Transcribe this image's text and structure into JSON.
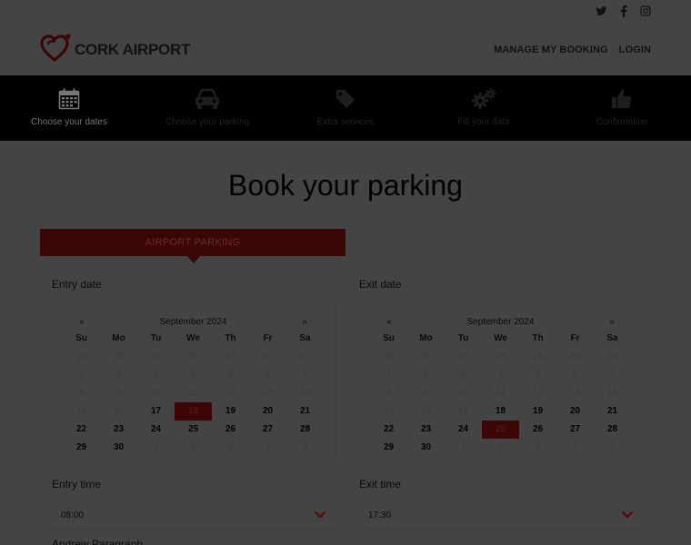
{
  "social": {
    "icons": [
      "twitter-icon",
      "facebook-icon",
      "instagram-icon"
    ]
  },
  "header": {
    "logo_text": "CORK AIRPORT",
    "nav": [
      "MANAGE MY BOOKING",
      "LOGIN"
    ]
  },
  "steps": [
    {
      "label": "Choose your dates",
      "icon": "calendar-icon"
    },
    {
      "label": "Choose your parking",
      "icon": "car-icon"
    },
    {
      "label": "Extra services",
      "icon": "tag-icon"
    },
    {
      "label": "Fill your data",
      "icon": "gears-icon"
    },
    {
      "label": "Confirmation",
      "icon": "thumbs-up-icon"
    }
  ],
  "page_title": "Book your parking",
  "tab_label": "AIRPORT PARKING",
  "entry": {
    "label": "Entry date",
    "prev": "«",
    "next": "»",
    "month": "September 2024",
    "days": [
      "Su",
      "Mo",
      "Tu",
      "We",
      "Th",
      "Fr",
      "Sa"
    ],
    "cells": [
      "25",
      "26",
      "27",
      "28",
      "29",
      "30",
      "31",
      "1",
      "2",
      "3",
      "4",
      "5",
      "6",
      "7",
      "8",
      "9",
      "10",
      "11",
      "12",
      "13",
      "14",
      "15",
      "16",
      "17",
      "18",
      "19",
      "20",
      "21",
      "22",
      "23",
      "24",
      "25",
      "26",
      "27",
      "28",
      "29",
      "30",
      "1",
      "2",
      "3",
      "4",
      "5"
    ],
    "first_available_index": 23,
    "last_available_index": 36,
    "selected_index": 24,
    "time_label": "Entry time",
    "time_value": "08:00"
  },
  "exit": {
    "label": "Exit date",
    "prev": "«",
    "next": "»",
    "month": "September 2024",
    "days": [
      "Su",
      "Mo",
      "Tu",
      "We",
      "Th",
      "Fr",
      "Sa"
    ],
    "cells": [
      "25",
      "26",
      "27",
      "28",
      "29",
      "30",
      "31",
      "1",
      "2",
      "3",
      "4",
      "5",
      "6",
      "7",
      "8",
      "9",
      "10",
      "11",
      "12",
      "13",
      "14",
      "15",
      "16",
      "17",
      "18",
      "19",
      "20",
      "21",
      "22",
      "23",
      "24",
      "25",
      "26",
      "27",
      "28",
      "29",
      "30",
      "1",
      "2",
      "3",
      "4",
      "5"
    ],
    "first_available_index": 24,
    "last_available_index": 36,
    "selected_index": 31,
    "time_label": "Exit time",
    "time_value": "17:30"
  },
  "colors": {
    "overlay_bg": "#444444",
    "brand_dark_red": "#3a0606",
    "nav_bg": "#000000",
    "chevron": "#5a0a0a"
  },
  "bottom_label": "Andrew Paragraph"
}
